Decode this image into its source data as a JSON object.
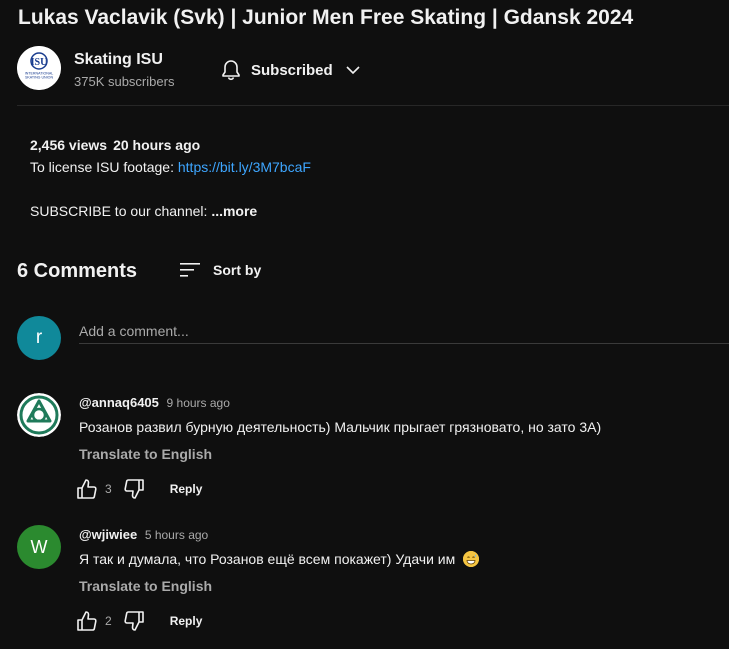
{
  "video": {
    "title": "Lukas Vaclavik (Svk) | Junior Men Free Skating | Gdansk 2024"
  },
  "channel": {
    "name": "Skating ISU",
    "subscribers": "375K subscribers",
    "logo_icon": "isu-logo-icon",
    "subscribe_label": "Subscribed",
    "logo_lines": [
      "INTERNATIONAL",
      "SKATING UNION"
    ]
  },
  "description": {
    "views": "2,456 views",
    "age": "20 hours ago",
    "license_label": "To license ISU footage:",
    "license_link": "https://bit.ly/3M7bcaF",
    "subscribe_line": "SUBSCRIBE to our channel:",
    "more_label": "...more"
  },
  "comments": {
    "count_label": "6 Comments",
    "sort_label": "Sort by",
    "add_placeholder": "Add a comment...",
    "current_user_initial": "r",
    "items": [
      {
        "author": "@annaq6405",
        "time": "9 hours ago",
        "text": "Розанов развил бурную деятельность) Мальчик прыгает грязновато, но зато 3А)",
        "translate": "Translate to English",
        "likes": "3",
        "reply": "Reply",
        "avatar_color": "#ffffff",
        "avatar_accent": "#1f7a5a"
      },
      {
        "author": "@wjiwiee",
        "time": "5 hours ago",
        "text": "Я так и думала, что Розанов ещё всем покажет) Удачи им",
        "translate": "Translate to English",
        "likes": "2",
        "reply": "Reply",
        "initial": "W",
        "avatar_color": "#2b8a2f",
        "emoji": "grinning-sweat-emoji"
      }
    ]
  },
  "colors": {
    "background": "#0f0f0f",
    "text": "#f1f1f1",
    "secondary_text": "#aaaaaa",
    "link": "#3ea6ff",
    "divider": "#272727"
  }
}
